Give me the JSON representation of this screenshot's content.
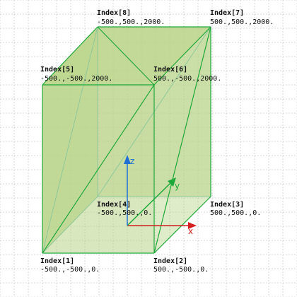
{
  "colors": {
    "background": "#ffffff",
    "grid": "#b8b8b8",
    "face_fill": "#b9d48a",
    "edge": "#1fa83a",
    "x_axis": "#d42020",
    "y_axis": "#1fa83a",
    "z_axis": "#1f6fd4"
  },
  "axes": {
    "x_label": "x",
    "y_label": "y",
    "z_label": "z"
  },
  "vertices": [
    {
      "index": "Index[1]",
      "coords": "-500.,-500.,0."
    },
    {
      "index": "Index[2]",
      "coords": "500.,-500.,0."
    },
    {
      "index": "Index[3]",
      "coords": "500.,500.,0."
    },
    {
      "index": "Index[4]",
      "coords": "-500.,500.,0."
    },
    {
      "index": "Index[5]",
      "coords": "-500.,-500.,2000."
    },
    {
      "index": "Index[6]",
      "coords": "500.,-500.,2000."
    },
    {
      "index": "Index[7]",
      "coords": "500.,500.,2000."
    },
    {
      "index": "Index[8]",
      "coords": "-500.,500.,2000."
    }
  ]
}
